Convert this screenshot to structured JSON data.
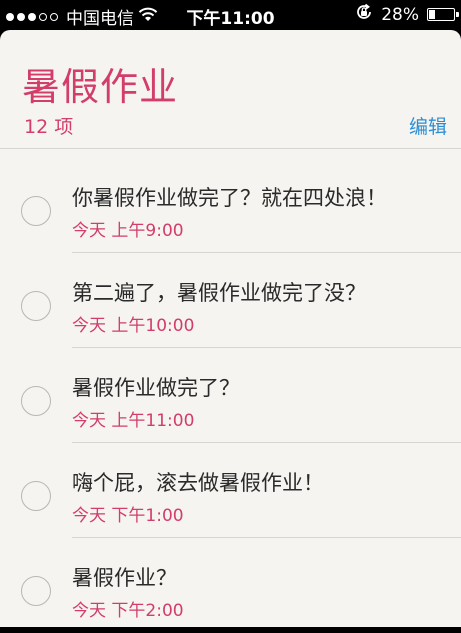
{
  "status_bar": {
    "carrier": "中国电信",
    "time": "下午11:00",
    "battery_percent": "28%",
    "battery_level": 0.28,
    "signal_dots_filled": 3,
    "signal_dots_total": 5,
    "icons": [
      "signal-dots-icon",
      "wifi-icon",
      "orientation-lock-icon",
      "battery-icon"
    ]
  },
  "list": {
    "title": "暑假作业",
    "count": "12 项",
    "edit_label": "编辑",
    "accent_color": "#d23d6a",
    "link_color": "#2d8fd3"
  },
  "items": [
    {
      "text": "你暑假作业做完了？就在四处浪！",
      "when": "今天 上午9:00"
    },
    {
      "text": "第二遍了，暑假作业做完了没？",
      "when": "今天 上午10:00"
    },
    {
      "text": "暑假作业做完了？",
      "when": "今天 上午11:00"
    },
    {
      "text": "嗨个屁，滚去做暑假作业！",
      "when": "今天 下午1:00"
    },
    {
      "text": "暑假作业？",
      "when": "今天 下午2:00"
    }
  ]
}
